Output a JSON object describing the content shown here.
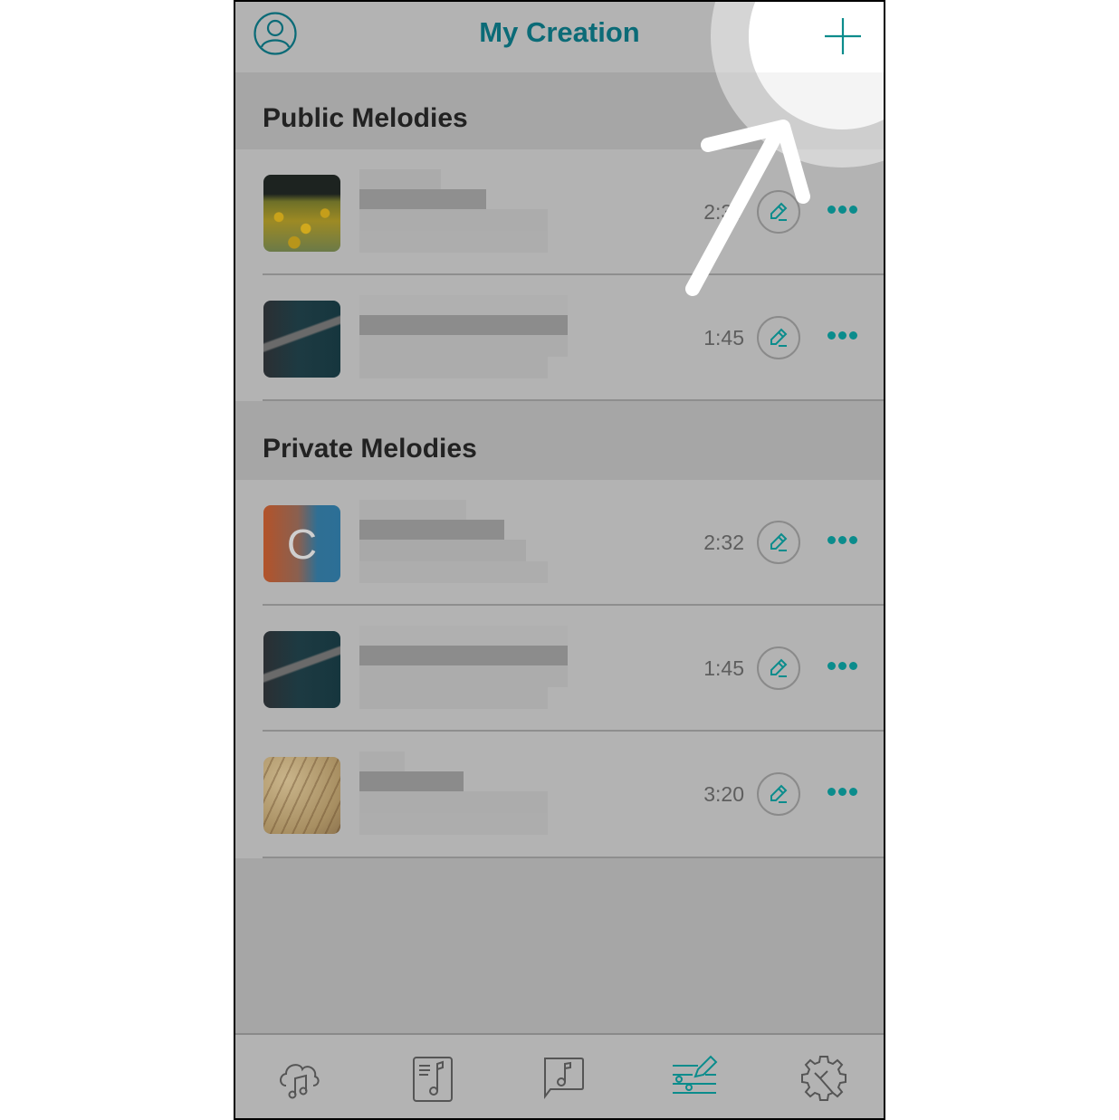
{
  "header": {
    "title": "My Creation",
    "profile_icon": "user-circle-icon",
    "add_icon": "plus-icon"
  },
  "sections": [
    {
      "title": "Public Melodies",
      "items": [
        {
          "thumbnail": "sunflower-field",
          "title": "[blurred]",
          "duration": "2:3?"
        },
        {
          "thumbnail": "guitar-player",
          "title": "[blurred]",
          "duration": "1:45"
        }
      ]
    },
    {
      "title": "Private Melodies",
      "items": [
        {
          "thumbnail": "letter-c",
          "thumbnail_letter": "C",
          "title": "[blurred]",
          "duration": "2:32"
        },
        {
          "thumbnail": "guitar-player",
          "title": "[blurred]",
          "duration": "1:45"
        },
        {
          "thumbnail": "sheet-music",
          "title": "[blurred]",
          "duration": "3:20"
        }
      ]
    }
  ],
  "row_actions": {
    "edit_icon": "pencil-icon",
    "more_icon": "more-dots-icon"
  },
  "tabbar": {
    "tabs": [
      {
        "name": "cloud-music",
        "icon": "cloud-music-icon",
        "active": false
      },
      {
        "name": "music-sheet",
        "icon": "music-sheet-icon",
        "active": false
      },
      {
        "name": "music-message",
        "icon": "music-message-icon",
        "active": false
      },
      {
        "name": "my-creation",
        "icon": "compose-sliders-icon",
        "active": true
      },
      {
        "name": "settings",
        "icon": "gear-wrench-icon",
        "active": false
      }
    ]
  },
  "overlay": {
    "hint": "tap-plus-to-create",
    "pointer": "arrow-icon"
  },
  "colors": {
    "accent": "#0b8c8c",
    "title": "#0b6b77",
    "overlay": "#b3b3b3"
  }
}
